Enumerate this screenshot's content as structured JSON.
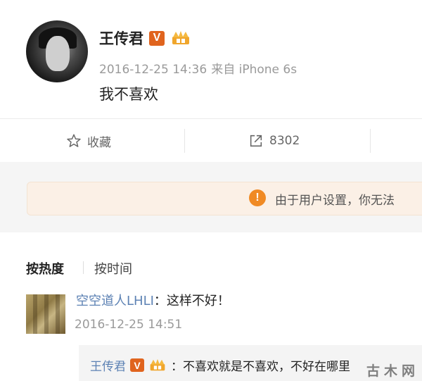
{
  "post": {
    "author": "王传君",
    "verified_badge": "V",
    "timestamp": "2016-12-25 14:36",
    "source": "来自 iPhone 6s",
    "text": "我不喜欢"
  },
  "actions": {
    "favorite_label": "收藏",
    "share_count": "8302"
  },
  "notice": {
    "icon": "!",
    "text": "由于用户设置，你无法"
  },
  "comments_section": {
    "sort_hot": "按热度",
    "sort_time": "按时间",
    "comments": [
      {
        "user": "空空道人LHLI",
        "colon": "：",
        "text": "这样不好！",
        "time": "2016-12-25 14:51",
        "reply": {
          "user": "王传君",
          "verified_badge": "V",
          "text": "：不喜欢就是不喜欢，不好在哪里"
        }
      }
    ]
  },
  "watermark": "古木网",
  "colors": {
    "username_link": "#5d82b4",
    "badge_orange": "#e0641e",
    "notice_bg": "#fbf0e6",
    "notice_icon": "#f08a24"
  }
}
